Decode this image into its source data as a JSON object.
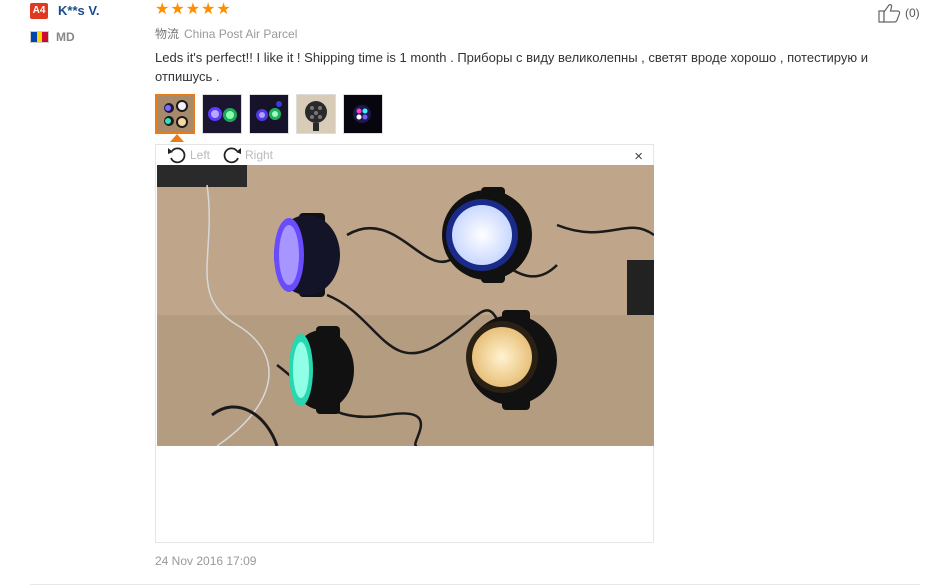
{
  "reviewer": {
    "level_badge": "A4",
    "name": "K**s V.",
    "country": "MD",
    "flag_colors": [
      "#0046ae",
      "#ffd200",
      "#cc092f"
    ]
  },
  "rating": {
    "stars": 5,
    "color": "#ff8f00"
  },
  "helpful": {
    "count_label": "(0)"
  },
  "shipping": {
    "label": "物流",
    "method": "China Post Air Parcel"
  },
  "review": {
    "text": "Leds it's perfect!! I like it ! Shipping time is 1 month . Приборы с виду великолепны , светят вроде хорошо , потестирую и отпишусь ."
  },
  "viewer": {
    "rotate_left_label": "Left",
    "rotate_right_label": "Right",
    "close_glyph": "×"
  },
  "date": "24 Nov 2016 17:09",
  "colors": {
    "accent": "#e87c19",
    "badge": "#e0391f",
    "name": "#1a4b8c"
  }
}
